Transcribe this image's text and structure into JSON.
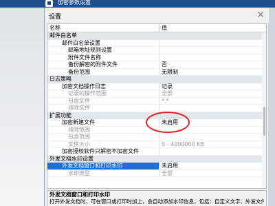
{
  "titlebar": {
    "title": "加密参数设置"
  },
  "dialog": {
    "header_title": "设置",
    "close_glyph": "✕",
    "columns": {
      "name": "名称",
      "value": "值"
    },
    "rows": [
      {
        "kind": "category",
        "name": "邮件白名单",
        "value": ""
      },
      {
        "kind": "item",
        "indent": 1,
        "name": "邮件白名单设置",
        "value": ""
      },
      {
        "kind": "item",
        "indent": 2,
        "name": "邮箱地址规则设置",
        "value": ""
      },
      {
        "kind": "item",
        "indent": 2,
        "name": "附件文件名称",
        "value": ""
      },
      {
        "kind": "item",
        "indent": 2,
        "name": "备份解密的附件文件",
        "value": "否"
      },
      {
        "kind": "item",
        "indent": 2,
        "name": "备份范围",
        "value": "无限制"
      },
      {
        "kind": "category",
        "name": "日志策略",
        "value": ""
      },
      {
        "kind": "item",
        "indent": 1,
        "name": "加密文档操作日志",
        "value": "记录"
      },
      {
        "kind": "item",
        "indent": 2,
        "name": "记录的操作范围",
        "value": "全部",
        "disabled": true
      },
      {
        "kind": "item",
        "indent": 2,
        "name": "包含文件",
        "value": "*.*",
        "disabled": true
      },
      {
        "kind": "item",
        "indent": 2,
        "name": "排除文件",
        "value": "",
        "disabled": true
      },
      {
        "kind": "category",
        "name": "扩展功能",
        "value": ""
      },
      {
        "kind": "item",
        "indent": 1,
        "name": "加密新建文件",
        "value": "未启用"
      },
      {
        "kind": "item",
        "indent": 2,
        "name": "排除范围",
        "value": "",
        "disabled": true
      },
      {
        "kind": "item",
        "indent": 2,
        "name": "包含范围",
        "value": "",
        "disabled": true
      },
      {
        "kind": "item",
        "indent": 2,
        "name": "文件大小",
        "value": "0 - 4000000 KB",
        "disabled": true
      },
      {
        "kind": "item",
        "indent": 1,
        "name": "加密授权软件只解密不加密文件",
        "value": ""
      },
      {
        "kind": "category",
        "name": "外发文档水印设置",
        "value": ""
      },
      {
        "kind": "item",
        "indent": 1,
        "name": "外发文档窗口和打印水印",
        "value": "未启用",
        "selected": true
      },
      {
        "kind": "item",
        "indent": 2,
        "name": "水印类型",
        "value": "全部",
        "disabled": true
      }
    ],
    "description": {
      "title": "外发文档窗口和打印水印",
      "body": "打开外发文档时，可在窗口或打印时加上，会自动添加水印信息，包括：自定义文字、外发文件的生成者信息、外发文件打开者信息等。"
    }
  },
  "colors": {
    "selection": "#1d6fe0",
    "highlight_circle": "#e21f1f",
    "titlebar": "#1f4e8c"
  }
}
